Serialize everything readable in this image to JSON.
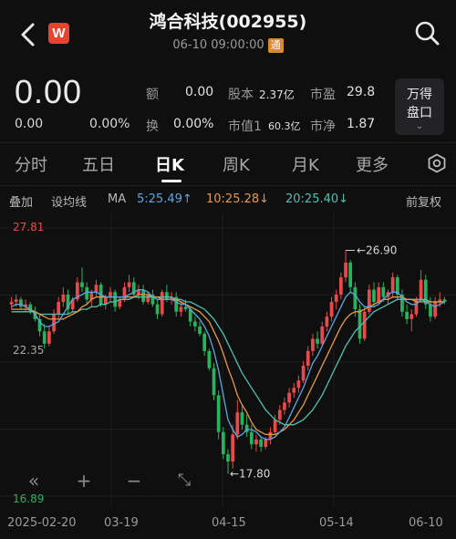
{
  "header": {
    "title": "鸿合科技(002955)",
    "subtitle": "06-10 09:00:00",
    "badge": "通",
    "logo": "W"
  },
  "quote": {
    "price": "0.00",
    "change": "0.00",
    "change_pct": "0.00%",
    "stats": [
      {
        "label": "额",
        "value": "0.00"
      },
      {
        "label": "换",
        "value": "0.00%"
      },
      {
        "label": "股本",
        "value": "2.37亿"
      },
      {
        "label": "市值1",
        "value": "60.3亿"
      },
      {
        "label": "市盈",
        "value": "29.8"
      },
      {
        "label": "市净",
        "value": "1.87"
      }
    ],
    "wande_line1": "万得",
    "wande_line2": "盘口"
  },
  "tabs": [
    "分时",
    "五日",
    "日K",
    "周K",
    "月K",
    "更多"
  ],
  "active_tab": "日K",
  "indicators": {
    "overlay": "叠加",
    "ma_setting": "设均线",
    "ma": "MA",
    "ma5": "5:25.49↑",
    "ma10": "10:25.28↓",
    "ma20": "20:25.40↓",
    "adjust": "前复权"
  },
  "colors": {
    "up": "#e84a4a",
    "down": "#29b25c",
    "ma5": "#5aa7e0",
    "ma10": "#e89a3c",
    "ma20": "#4fc0b0",
    "background": "#0f0f10"
  },
  "chart_data": {
    "type": "candlestick",
    "ylim": [
      16.89,
      27.81
    ],
    "y_top_label": "27.81",
    "y_mid_label": "22.35",
    "y_bottom_label": "16.89",
    "high_annotation": "26.90",
    "low_annotation": "17.80",
    "x_labels": [
      "2025-02-20",
      "03-19",
      "04-15",
      "05-14",
      "06-10"
    ],
    "candles": [
      [
        24.7,
        25.0,
        24.5,
        24.8
      ],
      [
        24.8,
        25.1,
        24.6,
        24.9
      ],
      [
        24.9,
        25.0,
        24.5,
        24.6
      ],
      [
        24.6,
        24.9,
        24.4,
        24.7
      ],
      [
        24.7,
        24.8,
        24.3,
        24.4
      ],
      [
        24.4,
        24.6,
        24.0,
        24.1
      ],
      [
        24.1,
        24.3,
        23.4,
        23.6
      ],
      [
        23.6,
        23.9,
        22.9,
        23.1
      ],
      [
        23.1,
        23.8,
        23.0,
        23.6
      ],
      [
        23.6,
        24.5,
        23.5,
        24.3
      ],
      [
        24.3,
        25.0,
        24.1,
        24.8
      ],
      [
        24.8,
        25.4,
        24.6,
        25.1
      ],
      [
        25.1,
        25.3,
        24.3,
        24.5
      ],
      [
        24.5,
        25.0,
        24.4,
        24.9
      ],
      [
        24.9,
        25.8,
        24.8,
        25.6
      ],
      [
        25.6,
        26.2,
        25.2,
        25.4
      ],
      [
        25.4,
        25.6,
        24.7,
        24.9
      ],
      [
        24.9,
        25.3,
        24.6,
        25.2
      ],
      [
        25.2,
        25.7,
        25.0,
        25.5
      ],
      [
        25.5,
        25.6,
        24.6,
        24.7
      ],
      [
        24.7,
        25.1,
        24.5,
        25.0
      ],
      [
        25.0,
        25.4,
        24.8,
        25.2
      ],
      [
        25.2,
        25.3,
        24.4,
        24.6
      ],
      [
        24.6,
        25.0,
        24.5,
        24.9
      ],
      [
        24.9,
        25.6,
        24.8,
        25.4
      ],
      [
        25.4,
        25.9,
        25.2,
        25.6
      ],
      [
        25.6,
        25.8,
        25.0,
        25.1
      ],
      [
        25.1,
        25.5,
        24.9,
        25.3
      ],
      [
        25.3,
        25.5,
        24.7,
        24.8
      ],
      [
        24.8,
        25.2,
        24.7,
        25.1
      ],
      [
        25.1,
        25.3,
        24.6,
        24.7
      ],
      [
        24.7,
        24.9,
        24.1,
        24.3
      ],
      [
        24.3,
        25.3,
        24.2,
        25.2
      ],
      [
        25.2,
        25.5,
        24.8,
        24.9
      ],
      [
        24.9,
        25.2,
        24.7,
        25.0
      ],
      [
        25.0,
        25.2,
        24.2,
        24.4
      ],
      [
        24.4,
        24.8,
        24.2,
        24.6
      ],
      [
        24.6,
        24.9,
        24.4,
        24.5
      ],
      [
        24.5,
        24.6,
        23.8,
        24.0
      ],
      [
        24.0,
        24.2,
        23.6,
        23.8
      ],
      [
        23.8,
        24.0,
        23.4,
        23.5
      ],
      [
        23.5,
        23.6,
        22.6,
        22.8
      ],
      [
        22.8,
        22.9,
        22.0,
        22.1
      ],
      [
        22.1,
        22.3,
        20.8,
        21.0
      ],
      [
        21.0,
        21.2,
        19.2,
        19.5
      ],
      [
        19.5,
        19.7,
        18.4,
        18.6
      ],
      [
        18.6,
        18.8,
        17.8,
        18.3
      ],
      [
        18.3,
        19.8,
        18.0,
        19.4
      ],
      [
        19.4,
        20.8,
        19.2,
        20.3
      ],
      [
        20.3,
        20.6,
        19.6,
        19.8
      ],
      [
        19.8,
        20.2,
        19.3,
        19.5
      ],
      [
        19.5,
        19.8,
        18.8,
        19.0
      ],
      [
        19.0,
        19.4,
        18.7,
        19.2
      ],
      [
        19.2,
        19.3,
        18.7,
        18.9
      ],
      [
        18.9,
        19.3,
        18.8,
        19.2
      ],
      [
        19.2,
        19.7,
        19.0,
        19.5
      ],
      [
        19.5,
        20.2,
        19.4,
        20.0
      ],
      [
        20.0,
        20.6,
        19.8,
        20.4
      ],
      [
        20.4,
        20.9,
        20.2,
        20.7
      ],
      [
        20.7,
        21.3,
        20.5,
        21.1
      ],
      [
        21.1,
        21.5,
        20.9,
        21.3
      ],
      [
        21.3,
        21.8,
        21.1,
        21.6
      ],
      [
        21.6,
        22.4,
        21.5,
        22.2
      ],
      [
        22.2,
        23.0,
        22.0,
        22.8
      ],
      [
        22.8,
        23.5,
        22.6,
        23.3
      ],
      [
        23.3,
        23.6,
        22.9,
        23.1
      ],
      [
        23.1,
        24.0,
        23.0,
        23.8
      ],
      [
        23.8,
        24.4,
        23.6,
        24.2
      ],
      [
        24.2,
        25.0,
        24.0,
        24.8
      ],
      [
        24.8,
        25.3,
        24.5,
        25.1
      ],
      [
        25.1,
        26.0,
        24.9,
        25.8
      ],
      [
        25.8,
        26.9,
        25.6,
        26.4
      ],
      [
        26.4,
        26.5,
        25.2,
        25.4
      ],
      [
        25.4,
        25.6,
        24.2,
        24.5
      ],
      [
        24.5,
        24.7,
        23.1,
        23.3
      ],
      [
        23.3,
        24.6,
        23.2,
        24.4
      ],
      [
        24.4,
        25.5,
        24.3,
        25.3
      ],
      [
        25.3,
        25.6,
        24.6,
        24.8
      ],
      [
        24.8,
        25.6,
        24.7,
        25.4
      ],
      [
        25.4,
        25.6,
        24.8,
        25.0
      ],
      [
        25.0,
        25.3,
        24.7,
        25.2
      ],
      [
        25.2,
        26.0,
        25.0,
        25.8
      ],
      [
        25.8,
        25.9,
        24.9,
        25.1
      ],
      [
        25.1,
        25.3,
        24.2,
        24.4
      ],
      [
        24.4,
        24.7,
        23.9,
        24.1
      ],
      [
        24.1,
        24.5,
        23.6,
        24.3
      ],
      [
        24.3,
        25.0,
        24.2,
        24.9
      ],
      [
        24.9,
        26.1,
        24.8,
        25.7
      ],
      [
        25.7,
        25.9,
        24.5,
        24.7
      ],
      [
        24.7,
        25.0,
        24.0,
        24.2
      ],
      [
        24.2,
        25.0,
        24.1,
        24.8
      ],
      [
        24.8,
        25.2,
        24.6,
        24.9
      ],
      [
        24.9,
        25.0,
        24.7,
        24.8
      ]
    ],
    "ma5": [
      24.6,
      24.7,
      24.7,
      24.6,
      24.5,
      24.3,
      24.0,
      23.8,
      23.8,
      23.9,
      24.0,
      24.3,
      24.6,
      24.9,
      25.0,
      25.1,
      25.2,
      25.2,
      25.2,
      25.1,
      25.0,
      25.0,
      25.0,
      25.0,
      25.0,
      25.1,
      25.2,
      25.3,
      25.3,
      25.2,
      25.0,
      24.9,
      24.9,
      24.9,
      24.9,
      24.8,
      24.7,
      24.7,
      24.5,
      24.3,
      24.1,
      23.8,
      23.4,
      22.8,
      22.0,
      21.0,
      20.0,
      19.6,
      19.3,
      19.4,
      19.6,
      19.6,
      19.5,
      19.3,
      19.2,
      19.2,
      19.3,
      19.5,
      19.7,
      20.1,
      20.5,
      20.9,
      21.3,
      21.8,
      22.3,
      22.6,
      23.0,
      23.4,
      23.8,
      24.2,
      24.6,
      25.0,
      25.2,
      25.1,
      24.8,
      24.6,
      24.6,
      24.6,
      24.7,
      24.9,
      25.1,
      25.2,
      25.2,
      25.0,
      24.8,
      24.7,
      24.7,
      24.9,
      24.8,
      24.7,
      24.6,
      24.7,
      24.8
    ],
    "ma10": [
      24.5,
      24.5,
      24.5,
      24.5,
      24.5,
      24.4,
      24.3,
      24.2,
      24.1,
      24.1,
      24.1,
      24.1,
      24.2,
      24.3,
      24.4,
      24.6,
      24.7,
      24.9,
      25.0,
      25.0,
      25.0,
      25.0,
      25.0,
      25.0,
      25.0,
      25.0,
      25.0,
      25.1,
      25.1,
      25.1,
      25.0,
      25.0,
      24.9,
      24.9,
      24.9,
      24.9,
      24.8,
      24.7,
      24.6,
      24.5,
      24.4,
      24.2,
      24.0,
      23.6,
      23.2,
      22.7,
      22.1,
      21.6,
      21.0,
      20.6,
      20.3,
      19.9,
      19.6,
      19.5,
      19.4,
      19.4,
      19.4,
      19.5,
      19.6,
      19.8,
      20.0,
      20.3,
      20.6,
      21.0,
      21.4,
      21.8,
      22.2,
      22.6,
      23.0,
      23.4,
      23.8,
      24.1,
      24.3,
      24.4,
      24.4,
      24.5,
      24.6,
      24.7,
      24.8,
      24.9,
      24.9,
      25.0,
      25.0,
      25.0,
      24.9,
      24.9,
      24.8,
      24.8,
      24.8,
      24.8,
      24.8,
      24.8,
      24.8
    ],
    "ma20": [
      24.4,
      24.4,
      24.4,
      24.4,
      24.4,
      24.4,
      24.3,
      24.3,
      24.3,
      24.3,
      24.3,
      24.3,
      24.3,
      24.4,
      24.4,
      24.5,
      24.5,
      24.6,
      24.6,
      24.7,
      24.7,
      24.8,
      24.8,
      24.9,
      24.9,
      24.9,
      25.0,
      25.0,
      25.0,
      25.0,
      25.0,
      25.0,
      25.0,
      25.0,
      25.0,
      24.9,
      24.9,
      24.8,
      24.8,
      24.7,
      24.6,
      24.5,
      24.3,
      24.1,
      23.8,
      23.5,
      23.1,
      22.7,
      22.3,
      21.9,
      21.6,
      21.3,
      21.0,
      20.7,
      20.4,
      20.2,
      20.0,
      19.9,
      19.8,
      19.8,
      19.8,
      19.9,
      20.0,
      20.2,
      20.4,
      20.7,
      21.0,
      21.4,
      21.8,
      22.2,
      22.6,
      23.0,
      23.3,
      23.6,
      23.8,
      24.0,
      24.2,
      24.4,
      24.5,
      24.6,
      24.7,
      24.8,
      24.9,
      24.9,
      24.9,
      24.9,
      24.9,
      24.9,
      24.9,
      24.8,
      24.8,
      24.8,
      24.8
    ]
  },
  "controls": {
    "collapse": "«",
    "zoom_in": "+",
    "zoom_out": "−",
    "fullscreen": "⤡"
  },
  "icons": {
    "back": "back-chevron-icon",
    "search": "search-icon",
    "settings": "settings-icon"
  }
}
